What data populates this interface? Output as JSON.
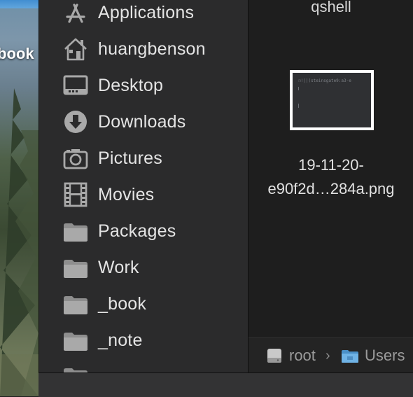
{
  "desktop": {
    "label": "book"
  },
  "sidebar": {
    "items": [
      {
        "label": "Applications",
        "icon": "applications-icon"
      },
      {
        "label": "huangbenson",
        "icon": "home-icon"
      },
      {
        "label": "Desktop",
        "icon": "desktop-icon"
      },
      {
        "label": "Downloads",
        "icon": "downloads-icon"
      },
      {
        "label": "Pictures",
        "icon": "camera-icon"
      },
      {
        "label": "Movies",
        "icon": "film-icon"
      },
      {
        "label": "Packages",
        "icon": "folder-icon"
      },
      {
        "label": "Work",
        "icon": "folder-icon"
      },
      {
        "label": "_book",
        "icon": "folder-icon"
      },
      {
        "label": "_note",
        "icon": "folder-icon"
      },
      {
        "label": "",
        "icon": "folder-icon"
      }
    ]
  },
  "files": {
    "top_label": "qshell",
    "selected": {
      "thumb_text": "❐!||(steinsgate9:a3-e",
      "name_line1": "19-11-20-",
      "name_line2": "e90f2d…284a.png"
    }
  },
  "pathbar": {
    "segments": [
      {
        "label": "root",
        "icon": "disk-icon"
      },
      {
        "label": "Users",
        "icon": "folder-icon"
      }
    ],
    "separator": "›"
  },
  "colors": {
    "sidebar_bg": "#2b2b2c",
    "pane_bg": "#1e1e1e",
    "text": "#e4e4e4",
    "icon_gray": "#a9a9a9"
  }
}
